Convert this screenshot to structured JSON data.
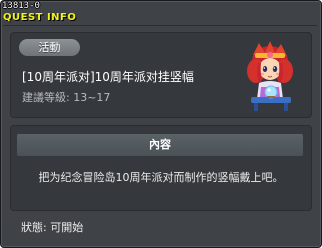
{
  "quest_id": "13813-0",
  "window": {
    "title": "QUEST INFO"
  },
  "quest": {
    "category": "活動",
    "name": "[10周年派对]10周年派对挂竖幅",
    "level_requirement": "建議等級: 13~17"
  },
  "content": {
    "header": "內容",
    "description": "把为纪念冒险岛10周年派对而制作的竖幅戴上吧。"
  },
  "status": "狀態:  可開始",
  "colors": {
    "title": "#f2f21c",
    "panel": "#35383c",
    "window": "#3f4246",
    "badge": "#7d8286"
  },
  "npc": {
    "icon": "girl-with-crystal-ball"
  }
}
